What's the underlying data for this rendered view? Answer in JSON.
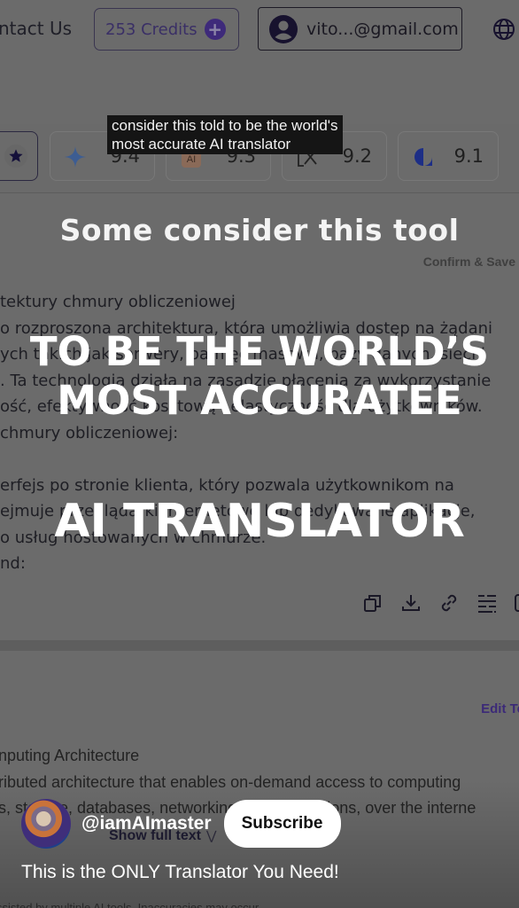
{
  "header": {
    "contact_label": "ntact Us",
    "credits_label": "253 Credits",
    "credits_add_icon": "plus-circle-icon",
    "account_email": "vito...@gmail.com",
    "account_icon": "user-circle-icon",
    "language_icon": "globe-icon"
  },
  "models": [
    {
      "icon": "star-icon",
      "score": "",
      "selected": true
    },
    {
      "icon": "sparkle-icon",
      "score": "9.4",
      "selected": false
    },
    {
      "icon": "ai-badge-icon",
      "score": "9.3",
      "selected": false
    },
    {
      "icon": "translate-icon",
      "score": "9.2",
      "selected": false
    },
    {
      "icon": "blue-drop-icon",
      "score": "9.1",
      "selected": false
    }
  ],
  "translation_panel": {
    "confirm_label": "Confirm & Save",
    "lines": [
      "tektury chmury obliczeniowej",
      "o rozproszona architektura, która umożliwia dostęp na żądani",
      "ych takich jak serwery, pamięć masowa, bazy danych, sieci i",
      ". Ta technologia działa na zasadzie płacenia za wykorzystanie",
      "ość, efektywność kosztową i elastyczność dla użytkowników.",
      "chmury obliczeniowej:",
      "",
      "erfejs po stronie klienta, który pozwala użytkownikom na",
      "ejmuje przeglądarki internetowe lub dedykowane aplikacje,",
      "o usług hostowanych w chmurze.",
      "nd:"
    ],
    "toolbar_icons": [
      "copy-icon",
      "download-icon",
      "link-icon",
      "align-icon",
      "more-icon"
    ]
  },
  "source_panel": {
    "edit_label": "Edit Te",
    "lines": [
      "nputing Architecture",
      "ributed architecture that enables on-demand access to computing",
      "s, storage, databases, networking and applications, over the interne"
    ],
    "disclaimer": "ssisted by multiple AI tools. Inaccuracies may occur."
  },
  "video": {
    "caption_line1": "consider this told to be the world's",
    "caption_line2": "most accurate AI translator",
    "overlay_line1": "Some consider this tool",
    "overlay_line2": "TO BE THE WORLD’S",
    "overlay_line3": "MOST ACCURATEE",
    "overlay_line4": "AI TRANSLATOR",
    "channel_handle": "@iamAImaster",
    "subscribe_label": "Subscribe",
    "show_full_label": "Show full text",
    "title": "This is the ONLY Translator You Need!"
  }
}
